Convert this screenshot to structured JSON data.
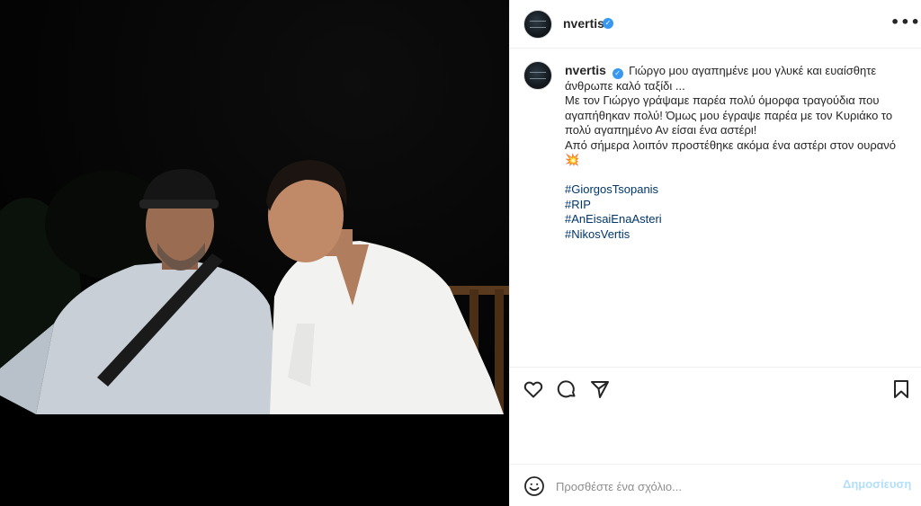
{
  "post": {
    "username": "nvertis",
    "verified_badge": "✓",
    "more_icon": "•••"
  },
  "caption": {
    "username": "nvertis",
    "lines": [
      "Γιώργο μου αγαπημένε μου γλυκέ και ευαίσθητε άνθρωπε καλό ταξίδι ...",
      "Με τον Γιώργο γράψαμε παρέα πολύ όμορφα τραγούδια που αγαπήθηκαν πολύ! Όμως μου έγραψε παρέα με τον Κυριάκο το πολύ αγαπημένο Αν είσαι ένα αστέρι!",
      "Από σήμερα λοιπόν προστέθηκε ακόμα ένα αστέρι στον ουρανό 💥"
    ],
    "hashtags": [
      "#GiorgosTsopanis",
      "#RIP",
      "#AnEisaiEnaAsteri",
      "#NikosVertis"
    ]
  },
  "actions": {
    "like_icon": "heart-icon",
    "comment_icon": "comment-bubble-icon",
    "share_icon": "paper-plane-icon",
    "save_icon": "bookmark-icon"
  },
  "comment_box": {
    "placeholder": "Προσθέστε ένα σχόλιο...",
    "value": "",
    "post_label": "Δημοσίευση",
    "emoji_icon": "smiley-icon"
  },
  "colors": {
    "verified": "#3897f0",
    "hashtag": "#00376b",
    "post_disabled": "#b2dffc",
    "divider": "#efefef"
  }
}
